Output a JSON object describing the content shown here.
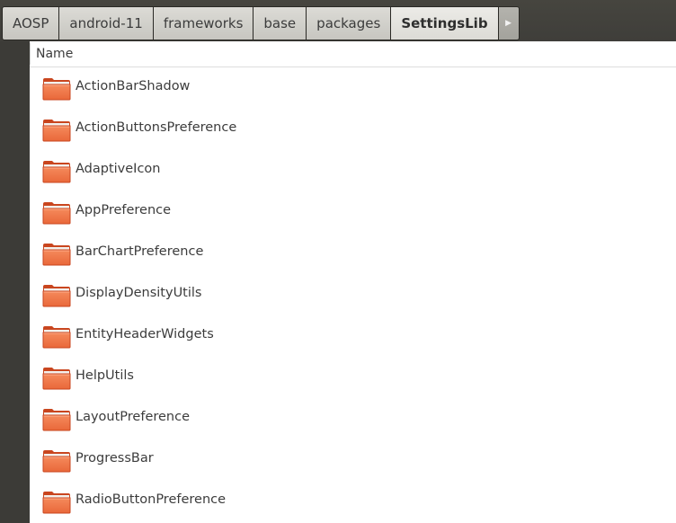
{
  "breadcrumb": {
    "items": [
      {
        "label": "AOSP"
      },
      {
        "label": "android-11"
      },
      {
        "label": "frameworks"
      },
      {
        "label": "base"
      },
      {
        "label": "packages"
      },
      {
        "label": "SettingsLib"
      }
    ],
    "scroll_icon": "triangle-right-icon"
  },
  "list": {
    "column_name": "Name",
    "items": [
      {
        "label": "ActionBarShadow",
        "icon": "folder-icon"
      },
      {
        "label": "ActionButtonsPreference",
        "icon": "folder-icon"
      },
      {
        "label": "AdaptiveIcon",
        "icon": "folder-icon"
      },
      {
        "label": "AppPreference",
        "icon": "folder-icon"
      },
      {
        "label": "BarChartPreference",
        "icon": "folder-icon"
      },
      {
        "label": "DisplayDensityUtils",
        "icon": "folder-icon"
      },
      {
        "label": "EntityHeaderWidgets",
        "icon": "folder-icon"
      },
      {
        "label": "HelpUtils",
        "icon": "folder-icon"
      },
      {
        "label": "LayoutPreference",
        "icon": "folder-icon"
      },
      {
        "label": "ProgressBar",
        "icon": "folder-icon"
      },
      {
        "label": "RadioButtonPreference",
        "icon": "folder-icon"
      }
    ]
  },
  "colors": {
    "folder_orange": "#e9683a",
    "folder_orange_dark": "#c9461f",
    "frame_dark": "#3c3b37",
    "text": "#3c3c3c"
  }
}
